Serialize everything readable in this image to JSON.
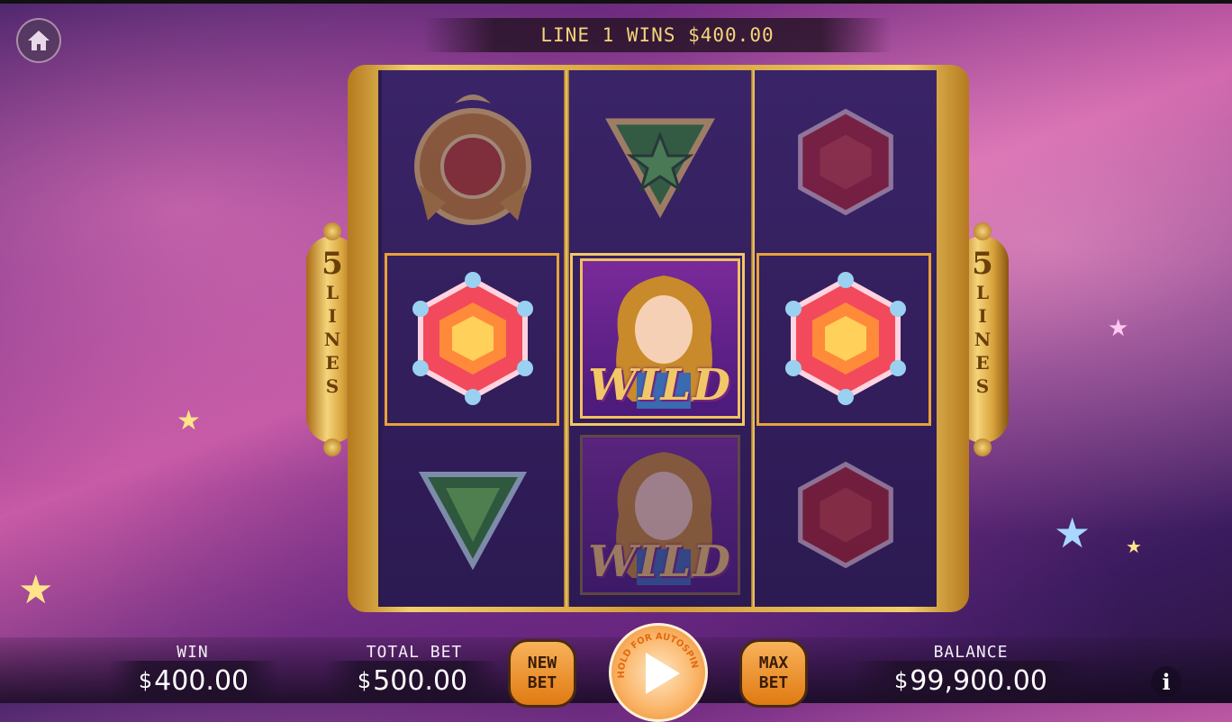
{
  "banner": {
    "text": "LINE 1 WINS $400.00"
  },
  "side_badges": {
    "number": "5",
    "letters": [
      "L",
      "I",
      "N",
      "E",
      "S"
    ]
  },
  "grid": {
    "reels": [
      [
        "sun-emblem",
        "red-gem",
        "green-gem"
      ],
      [
        "star-shield",
        "wild",
        "wild"
      ],
      [
        "red-gem",
        "red-gem",
        "red-gem"
      ]
    ],
    "winning_row": 1,
    "wild_label": "WILD"
  },
  "footer": {
    "win_label": "WIN",
    "win_currency": "$",
    "win_value": "400.00",
    "total_bet_label": "TOTAL BET",
    "total_bet_currency": "$",
    "total_bet_value": "500.00",
    "new_bet_line1": "NEW",
    "new_bet_line2": "BET",
    "spin_hint": "HOLD FOR AUTOSPIN",
    "max_bet_line1": "MAX",
    "max_bet_line2": "BET",
    "balance_label": "BALANCE",
    "balance_currency": "$",
    "balance_value": "99,900.00",
    "info_symbol": "i"
  },
  "icons": {
    "home": "home-icon",
    "play": "play-icon",
    "info": "info-icon"
  }
}
